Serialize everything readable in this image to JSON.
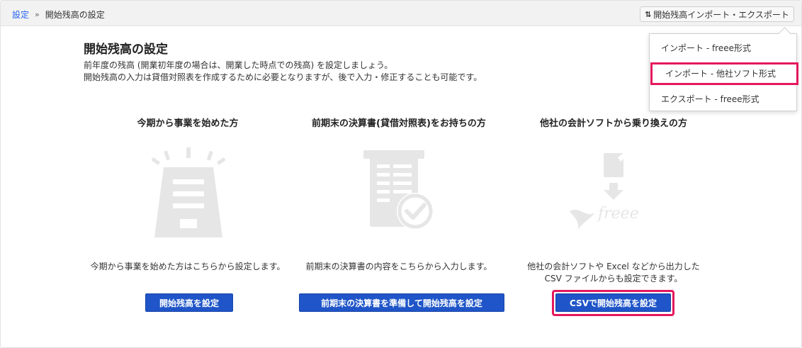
{
  "breadcrumb": {
    "root": "設定",
    "separator": "»",
    "current": "開始残高の設定"
  },
  "header": {
    "import_export_label": "開始残高インポート・エクスポート",
    "import_export_icon": "import-export-icon"
  },
  "dropdown": {
    "items": [
      {
        "label": "インポート - freee形式"
      },
      {
        "label": "インポート - 他社ソフト形式"
      },
      {
        "label": "エクスポート - freee形式"
      }
    ]
  },
  "main": {
    "title": "開始残高の設定",
    "description_line1": "前年度の残高 (開業初年度の場合は、開業した時点での残高) を設定しましょう。",
    "description_line2": "開始残高の入力は貸借対照表を作成するために必要となりますが、後で入力・修正することも可能です。"
  },
  "columns": [
    {
      "title": "今期から事業を始めた方",
      "text_line1": "今期から事業を始めた方はこちらから設定します。",
      "text_line2": "",
      "button": "開始残高を設定"
    },
    {
      "title": "前期末の決算書(貸借対照表)をお持ちの方",
      "text_line1": "前期末の決算書の内容をこちらから入力します。",
      "text_line2": "",
      "button": "前期末の決算書を準備して開始残高を設定"
    },
    {
      "title": "他社の会計ソフトから乗り換えの方",
      "text_line1": "他社の会計ソフトや Excel などから出力した",
      "text_line2": "CSV ファイルからも設定できます。",
      "button": "CSVで開始残高を設定"
    }
  ],
  "colors": {
    "primary_button": "#1f55c8",
    "highlight": "#e4185e",
    "link": "#2864f0",
    "illustration": "#e6e6e6"
  }
}
